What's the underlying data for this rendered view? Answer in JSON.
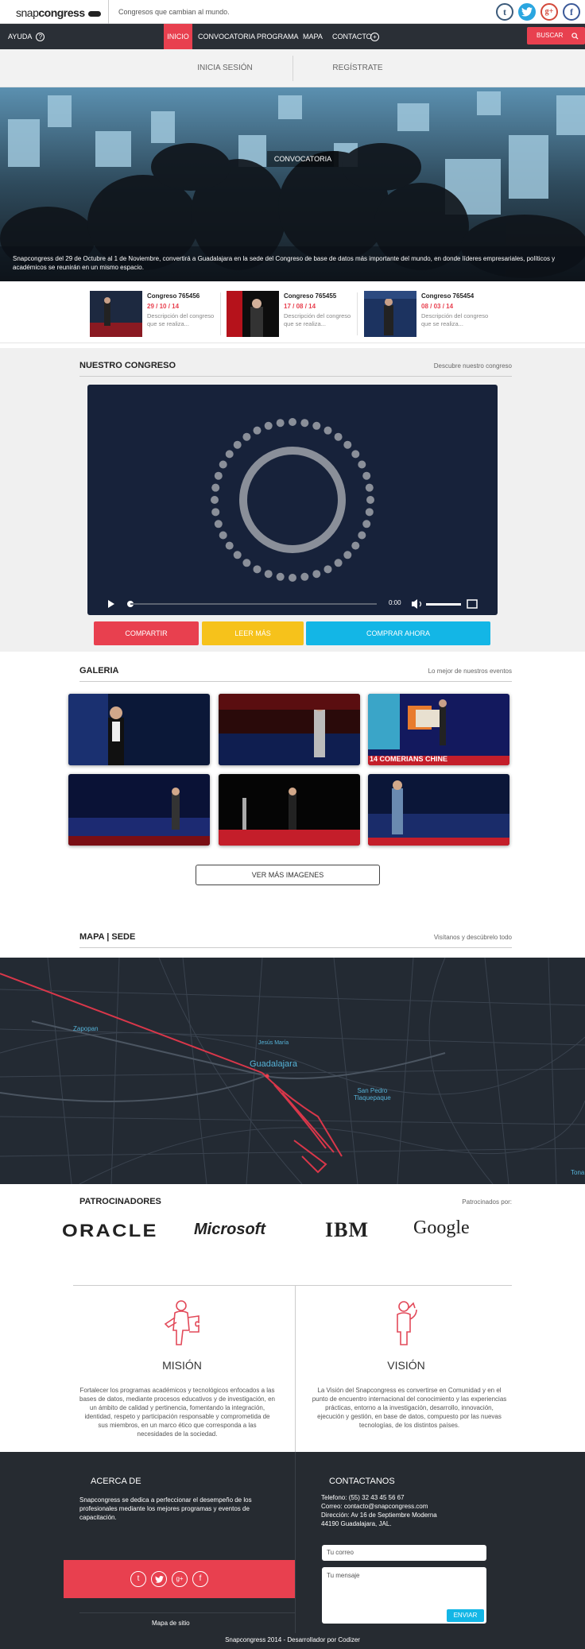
{
  "header": {
    "logo_snap": "snap",
    "logo_congress": "congress",
    "tagline": "Congresos que cambian al mundo.",
    "social": [
      {
        "icon": "tumblr-icon",
        "glyph": "t",
        "color": "#3b5a7a"
      },
      {
        "icon": "twitter-icon",
        "glyph": "t",
        "color": "#2aa6e0"
      },
      {
        "icon": "googleplus-icon",
        "glyph": "g+",
        "color": "#d3483a"
      },
      {
        "icon": "facebook-icon",
        "glyph": "f",
        "color": "#3b5998"
      }
    ]
  },
  "nav": {
    "help": "AYUDA",
    "help_icon": "?",
    "items": [
      "INICIO",
      "CONVOCATORIA",
      "PROGRAMA",
      "MAPA",
      "CONTACTO"
    ],
    "plus_icon": "+",
    "search": "BUSCAR"
  },
  "login": {
    "signin": "INICIA SESIÓN",
    "signup": "REGÍSTRATE"
  },
  "hero": {
    "title": "CONVOCATORIA",
    "caption": "Snapcongress del 29 de Octubre al 1 de Noviembre, convertirá a Guadalajara en la sede del Congreso de base de datos más importante del mundo, en donde líderes empresariales, políticos y académicos se reunirán en un mismo espacio."
  },
  "news": [
    {
      "title": "Congreso 765456",
      "date": "29 / 10 / 14",
      "desc": "Descripción del congreso que se realiza..."
    },
    {
      "title": "Congreso 765455",
      "date": "17 / 08 / 14",
      "desc": "Descripción del congreso que se realiza..."
    },
    {
      "title": "Congreso 765454",
      "date": "08 / 03 / 14",
      "desc": "Descripción del congreso que se realiza..."
    }
  ],
  "congreso": {
    "title": "NUESTRO CONGRESO",
    "subtitle": "Descubre nuestro congreso",
    "time": "0:00",
    "buttons": [
      {
        "label": "COMPARTIR",
        "color": "#e8404f"
      },
      {
        "label": "LEER MÁS",
        "color": "#f6c21b"
      },
      {
        "label": "COMPRAR AHORA",
        "color": "#13b6e6"
      }
    ]
  },
  "galeria": {
    "title": "GALERIA",
    "subtitle": "Lo mejor de nuestros eventos",
    "slide_text": "14 COMERIANS CHINE",
    "more": "VER MÁS IMAGENES"
  },
  "mapa": {
    "title": "MAPA | SEDE",
    "subtitle": "Visítanos y descúbrelo todo",
    "labels": {
      "zapopan": "Zapopan",
      "jesus": "Jesús María",
      "gdl": "Guadalajara",
      "sanpedro1": "San Pedro",
      "sanpedro2": "Tlaquepaque",
      "tona": "Tona"
    }
  },
  "patrocinadores": {
    "title": "PATROCINADORES",
    "subtitle": "Patrocinados por:",
    "logos": [
      "ORACLE",
      "Microsoft",
      "IBM",
      "Google"
    ]
  },
  "mision": {
    "title": "MISIÓN",
    "text": "Fortalecer los programas académicos y tecnológicos enfocados a las bases de datos, mediante procesos educativos y de investigación, en un ámbito de calidad y pertinencia, fomentando la integración, identidad, respeto y participación responsable y comprometida de sus miembros, en un marco ético que corresponda a las necesidades de la sociedad."
  },
  "vision": {
    "title": "VISIÓN",
    "text": "La Visión del Snapcongress es convertirse en Comunidad y en el punto de encuentro internacional del conocimiento y las experiencias prácticas, entorno a la investigación, desarrollo, innovación, ejecución y gestión, en base de datos, compuesto por las nuevas tecnologías, de los distintos países."
  },
  "footer": {
    "about_title": "ACERCA DE",
    "about_text": "Snapcongress se dedica a perfeccionar el desempeño de los profesionales mediante los mejores programas y eventos de capacitación.",
    "contact_title": "CONTACTANOS",
    "phone": "Telefono: (55) 32 43 45 56 67",
    "email": "Correo: contacto@snapcongress.com",
    "address1": "Dirección: Av 16 de Septiembre Moderna",
    "address2": "44190 Guadalajara, JAL.",
    "email_placeholder": "Tu correo",
    "message_placeholder": "Tu mensaje",
    "send": "ENVIAR",
    "sitemap": "Mapa de sitio",
    "copyright": "Snapcongress 2014 - Desarrollador por Codizer"
  }
}
